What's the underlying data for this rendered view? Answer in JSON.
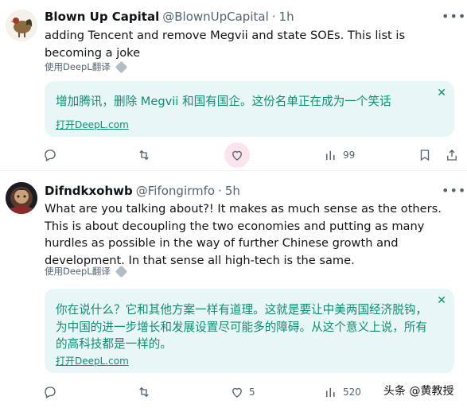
{
  "tweets": [
    {
      "name": "Blown Up Capital",
      "handle": "@BlownUpCapital",
      "time": "1h",
      "text": "adding Tencent and remove Megvii and state SOEs. This list is becoming a joke",
      "translate_label": "使用DeepL翻译",
      "translation": "增加腾讯，删除 Megvii 和国有国企。这份名单正在成为一个笑话",
      "open_link": "打开DeepL.com",
      "likes": "",
      "views": "99",
      "liked_state": "active"
    },
    {
      "name": "Difndkxohwb",
      "handle": "@Fifongirmfo",
      "time": "5h",
      "text": "What are you talking about?! It makes as much sense as the others. This is about decoupling the two economies and putting as many hurdles as possible in the way of further Chinese growth and development. In that sense all high-tech is the same.",
      "translate_label": "使用DeepL翻译",
      "translation": "你在说什么？它和其他方案一样有道理。这就是要让中美两国经济脱钩，为中国的进一步增长和发展设置尽可能多的障碍。从这个意义上说，所有的高科技都是一样的。",
      "open_link": "打开DeepL.com",
      "likes": "5",
      "views": "520"
    }
  ],
  "icons": {
    "more": "more-icon",
    "reply": "reply-icon",
    "retweet": "retweet-icon",
    "like": "heart-icon",
    "views": "views-icon",
    "bookmark": "bookmark-icon",
    "share": "share-icon",
    "close": "close-icon"
  },
  "colors": {
    "teal_text": "#0f8b78",
    "teal_bg": "#e8f7f5",
    "muted": "#536471",
    "like_bg": "#fbe4ee"
  },
  "watermark": "头条 @黄教授"
}
